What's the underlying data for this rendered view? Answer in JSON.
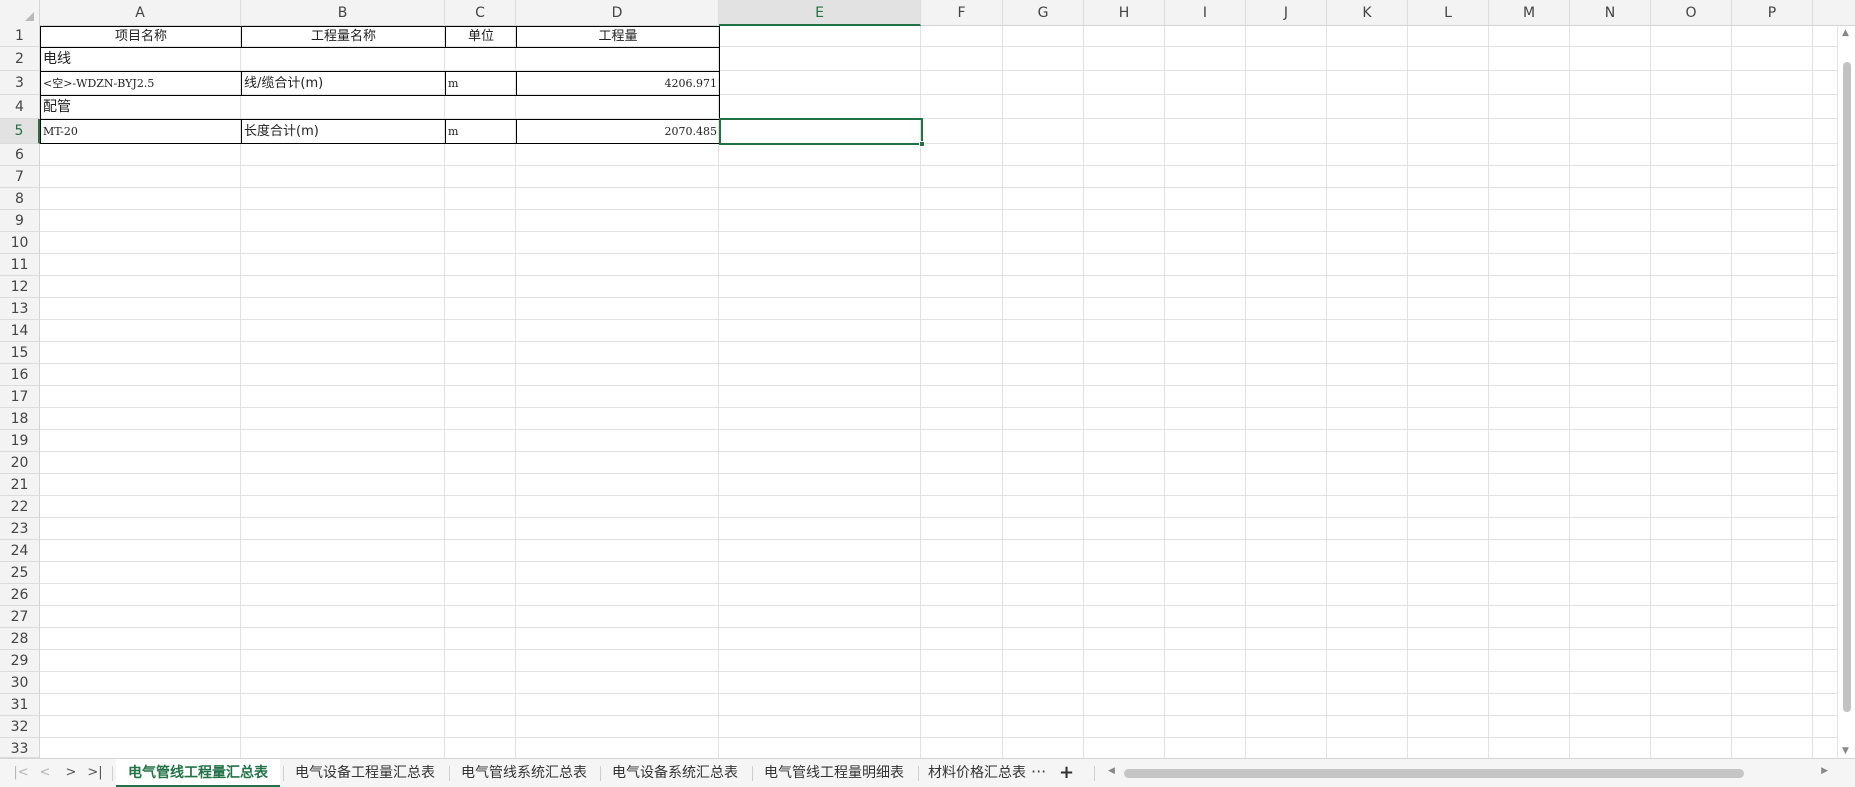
{
  "columns": [
    "A",
    "B",
    "C",
    "D",
    "E",
    "F",
    "G",
    "H",
    "I",
    "J",
    "K",
    "L",
    "M",
    "N",
    "O",
    "P"
  ],
  "rows": [
    "1",
    "2",
    "3",
    "4",
    "5",
    "6",
    "7",
    "8",
    "9",
    "10",
    "11",
    "12",
    "13",
    "14",
    "15",
    "16",
    "17",
    "18",
    "19",
    "20",
    "21",
    "22",
    "23",
    "24",
    "25",
    "26",
    "27",
    "28",
    "29",
    "30",
    "31",
    "32",
    "33"
  ],
  "selected": {
    "column": "E",
    "row": "5"
  },
  "table": {
    "headers": [
      "项目名称",
      "工程量名称",
      "单位",
      "工程量"
    ],
    "sections": [
      {
        "category": "电线",
        "row": {
          "item": "<空>-WDZN-BYJ2.5",
          "measure": "线/缆合计(m)",
          "unit": "m",
          "quantity": "4206.971"
        }
      },
      {
        "category": "配管",
        "row": {
          "item": "MT-20",
          "measure": "长度合计(m)",
          "unit": "m",
          "quantity": "2070.485"
        }
      }
    ]
  },
  "sheet_tabs": [
    "电气管线工程量汇总表",
    "电气设备工程量汇总表",
    "电气管线系统汇总表",
    "电气设备系统汇总表",
    "电气管线工程量明细表",
    "材料价格汇总表"
  ],
  "active_tab_index": 0,
  "tab_more_label": "···",
  "tab_add_label": "+",
  "nav_icons": [
    "first-sheet-icon",
    "prev-sheet-icon",
    "next-sheet-icon",
    "last-sheet-icon"
  ],
  "colors": {
    "accent": "#217346",
    "gridline": "#e1e1e1",
    "header_bg": "#f3f3f3"
  }
}
